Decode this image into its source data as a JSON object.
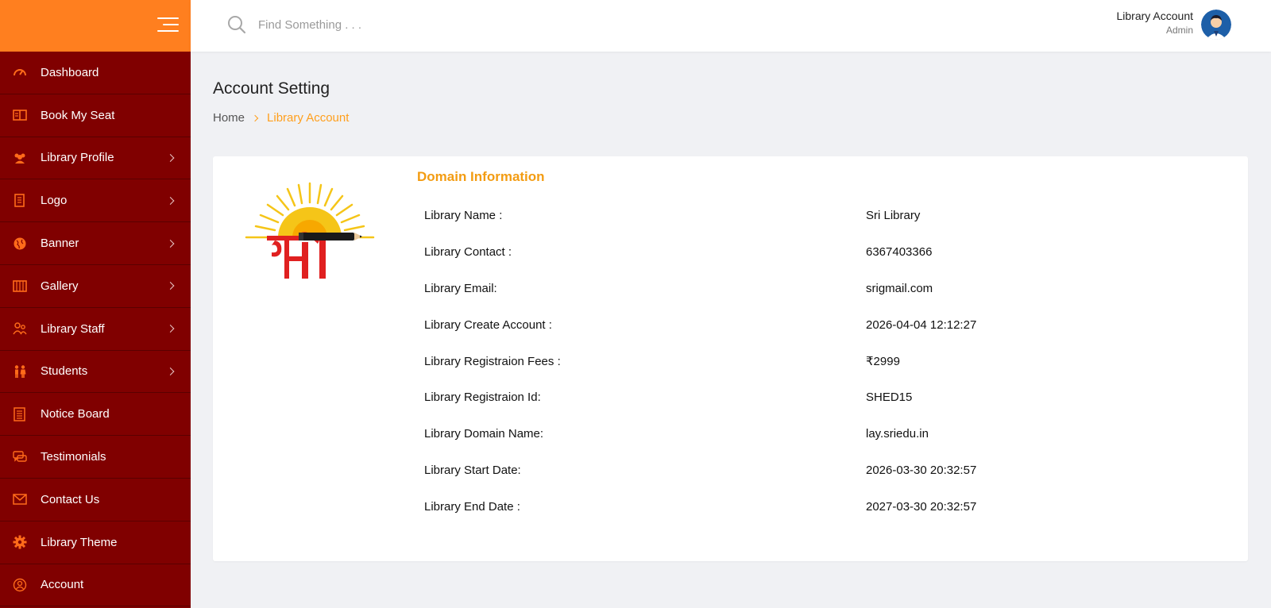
{
  "sidebar": {
    "menu_icon": "hamburger-icon",
    "items": [
      {
        "label": "Dashboard",
        "icon": "speedometer-icon",
        "has_submenu": false
      },
      {
        "label": "Book My Seat",
        "icon": "book-open-icon",
        "has_submenu": false
      },
      {
        "label": "Library Profile",
        "icon": "users-group-icon",
        "has_submenu": true
      },
      {
        "label": "Logo",
        "icon": "document-icon",
        "has_submenu": true
      },
      {
        "label": "Banner",
        "icon": "globe-icon",
        "has_submenu": true
      },
      {
        "label": "Gallery",
        "icon": "gallery-icon",
        "has_submenu": true
      },
      {
        "label": "Library Staff",
        "icon": "staff-icon",
        "has_submenu": true
      },
      {
        "label": "Students",
        "icon": "students-icon",
        "has_submenu": true
      },
      {
        "label": "Notice Board",
        "icon": "notice-list-icon",
        "has_submenu": false
      },
      {
        "label": "Testimonials",
        "icon": "chat-bubbles-icon",
        "has_submenu": false
      },
      {
        "label": "Contact Us",
        "icon": "envelope-icon",
        "has_submenu": false
      },
      {
        "label": "Library Theme",
        "icon": "gear-icon",
        "has_submenu": false
      },
      {
        "label": "Account",
        "icon": "account-circle-icon",
        "has_submenu": false
      }
    ]
  },
  "header": {
    "search_placeholder": "Find Something . . .",
    "user_name": "Library Account",
    "user_role": "Admin"
  },
  "page": {
    "title": "Account Setting",
    "breadcrumb": {
      "home": "Home",
      "current": "Library Account"
    }
  },
  "card": {
    "section_title": "Domain Information",
    "rows": [
      {
        "label": "Library Name :",
        "value": "Sri Library"
      },
      {
        "label": "Library Contact :",
        "value": "6367403366"
      },
      {
        "label": "Library Email:",
        "value": "srigmail.com"
      },
      {
        "label": "Library Create Account :",
        "value": "2026-04-04 12:12:27"
      },
      {
        "label": "Library Registraion Fees :",
        "value": "₹2999"
      },
      {
        "label": "Library Registraion Id:",
        "value": "SHED15"
      },
      {
        "label": "Library Domain Name:",
        "value": "lay.sriedu.in"
      },
      {
        "label": "Library Start Date:",
        "value": "2026-03-30 20:32:57"
      },
      {
        "label": "Library End Date :",
        "value": "2027-03-30 20:32:57"
      }
    ]
  },
  "colors": {
    "sidebar_bg": "#800000",
    "brand_orange": "#ff7f1f",
    "accent": "#f39c12",
    "icon_orange": "#ff6b1a"
  }
}
